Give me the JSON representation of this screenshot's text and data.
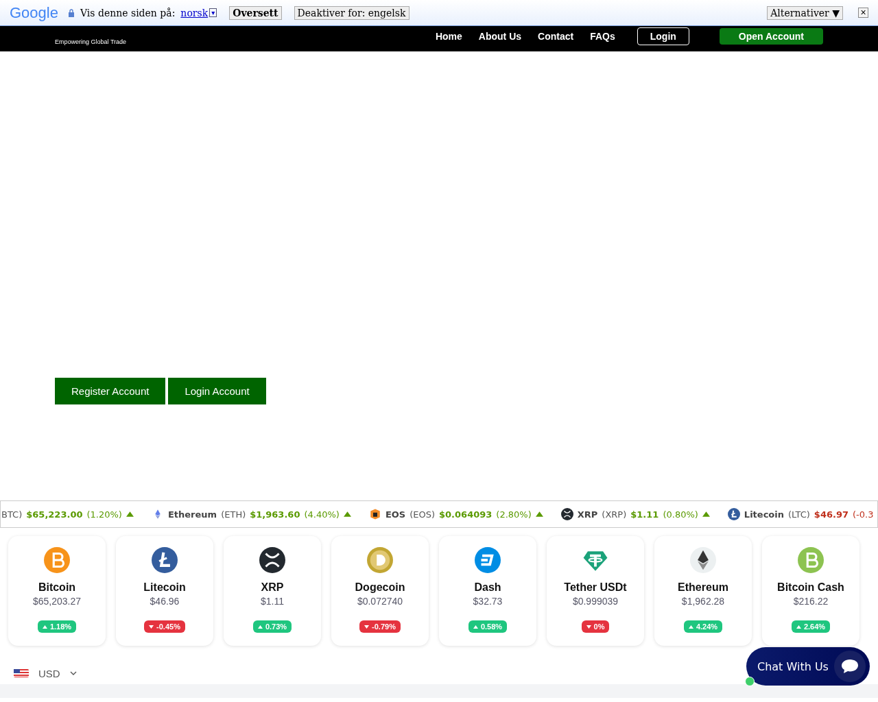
{
  "translate_bar": {
    "logo": "Google",
    "prompt": "Vis denne siden på:",
    "language": "norsk",
    "dropdown": "▾",
    "translate_button": "Oversett",
    "disable_button": "Deaktiver for: engelsk",
    "options_button": "Alternativer ▼",
    "close": "×"
  },
  "header": {
    "tagline": "Empowering Global Trade",
    "nav": [
      "Home",
      "About Us",
      "Contact",
      "FAQs"
    ],
    "login": "Login",
    "open_account": "Open Account"
  },
  "hero": {
    "buttons": [
      "Register Account",
      "Login Account"
    ]
  },
  "ticker": [
    {
      "symbol": "BTC)",
      "price": "$65,223.00",
      "change": "(1.20%)",
      "rising": true,
      "arrow": true
    },
    {
      "kind": "eth",
      "name": "Ethereum",
      "symbol": "(ETH)",
      "price": "$1,963.60",
      "change": "(4.40%)",
      "rising": true,
      "arrow": true
    },
    {
      "kind": "eos",
      "name": "EOS",
      "symbol": "(EOS)",
      "price": "$0.064093",
      "change": "(2.80%)",
      "rising": true,
      "arrow": true
    },
    {
      "kind": "xrp",
      "name": "XRP",
      "symbol": "(XRP)",
      "price": "$1.11",
      "change": "(0.80%)",
      "rising": true,
      "arrow": true
    },
    {
      "kind": "ltc",
      "name": "Litecoin",
      "symbol": "(LTC)",
      "price": "$46.97",
      "change": "(-0.3",
      "rising": false,
      "arrow": false
    }
  ],
  "cards": [
    {
      "kind": "btc",
      "name": "Bitcoin",
      "price": "$65,203.27",
      "change": "1.18%",
      "rising": true
    },
    {
      "kind": "ltc",
      "name": "Litecoin",
      "price": "$46.96",
      "change": "-0.45%",
      "rising": false
    },
    {
      "kind": "xrp",
      "name": "XRP",
      "price": "$1.11",
      "change": "0.73%",
      "rising": true
    },
    {
      "kind": "doge",
      "name": "Dogecoin",
      "price": "$0.072740",
      "change": "-0.79%",
      "rising": false
    },
    {
      "kind": "dash",
      "name": "Dash",
      "price": "$32.73",
      "change": "0.58%",
      "rising": true
    },
    {
      "kind": "usdt",
      "name": "Tether USDt",
      "price": "$0.999039",
      "change": "0%",
      "rising": false
    },
    {
      "kind": "eth",
      "name": "Ethereum",
      "price": "$1,962.28",
      "change": "4.24%",
      "rising": true
    },
    {
      "kind": "bch",
      "name": "Bitcoin Cash",
      "price": "$216.22",
      "change": "2.64%",
      "rising": true
    }
  ],
  "currency": {
    "label": "USD"
  },
  "chat": {
    "label": "Chat With Us",
    "online": true
  }
}
